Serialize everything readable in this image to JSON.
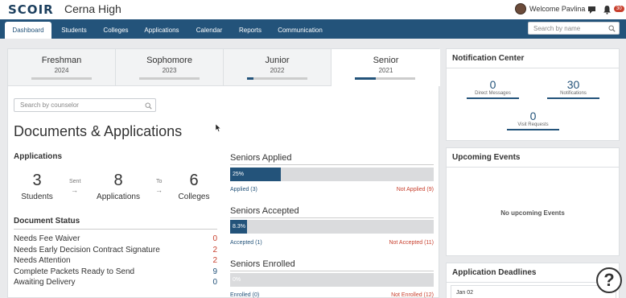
{
  "app": {
    "logo": "SCOIR",
    "school": "Cerna High"
  },
  "header": {
    "welcome": "Welcome Pavlina",
    "badge": "30"
  },
  "nav": {
    "tabs": [
      "Dashboard",
      "Students",
      "Colleges",
      "Applications",
      "Calendar",
      "Reports",
      "Communication"
    ],
    "search_placeholder": "Search by name"
  },
  "years": [
    {
      "name": "Freshman",
      "year": "2024",
      "progress": 0
    },
    {
      "name": "Sophomore",
      "year": "2023",
      "progress": 0
    },
    {
      "name": "Junior",
      "year": "2022",
      "progress": 0.1
    },
    {
      "name": "Senior",
      "year": "2021",
      "progress": 0.35
    }
  ],
  "main": {
    "counselor_placeholder": "Search by counselor",
    "title": "Documents & Applications",
    "applications": {
      "heading": "Applications",
      "students_count": "3",
      "students_label": "Students",
      "sent_label": "Sent",
      "applications_count": "8",
      "applications_label": "Applications",
      "to_label": "To",
      "colleges_count": "6",
      "colleges_label": "Colleges"
    },
    "document_status": {
      "heading": "Document Status",
      "rows": [
        {
          "label": "Needs Fee Waiver",
          "value": "0",
          "color": "#c8402e"
        },
        {
          "label": "Needs Early Decision Contract Signature",
          "value": "2",
          "color": "#c8402e"
        },
        {
          "label": "Needs Attention",
          "value": "2",
          "color": "#c8402e"
        },
        {
          "label": "Complete Packets Ready to Send",
          "value": "9",
          "color": "#23537a"
        },
        {
          "label": "Awaiting Delivery",
          "value": "0",
          "color": "#23537a"
        }
      ]
    },
    "seniors": [
      {
        "title": "Seniors Applied",
        "percent_label": "25%",
        "fraction": 0.25,
        "left": "Applied (3)",
        "right": "Not Applied (9)"
      },
      {
        "title": "Seniors Accepted",
        "percent_label": "8.3%",
        "fraction": 0.083,
        "left": "Accepted (1)",
        "right": "Not Accepted (11)"
      },
      {
        "title": "Seniors Enrolled",
        "percent_label": "0%",
        "fraction": 0,
        "left": "Enrolled (0)",
        "right": "Not Enrolled (12)"
      }
    ]
  },
  "notification_center": {
    "title": "Notification Center",
    "direct_messages": {
      "count": "0",
      "label": "Direct Messages"
    },
    "notifications": {
      "count": "30",
      "label": "Notifications"
    },
    "visit_requests": {
      "count": "0",
      "label": "Visit Requests"
    }
  },
  "upcoming_events": {
    "title": "Upcoming Events",
    "empty": "No upcoming Events"
  },
  "application_deadlines": {
    "title": "Application Deadlines",
    "first_date": "Jan 02"
  },
  "help": {
    "label": "?"
  }
}
